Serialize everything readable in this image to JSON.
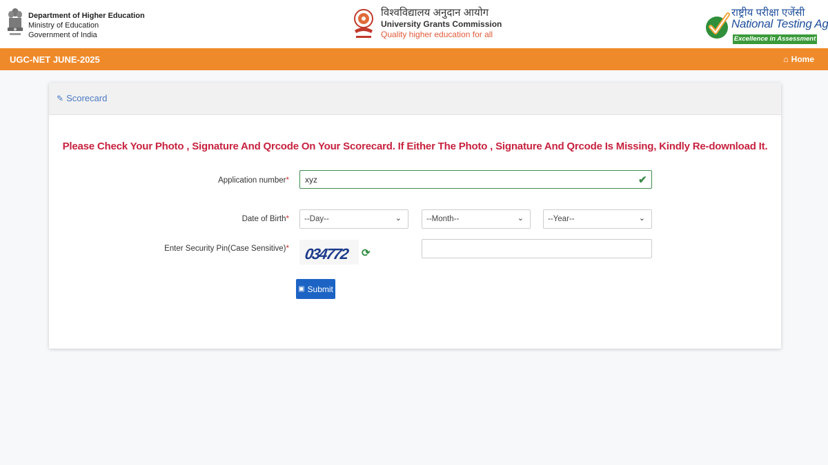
{
  "header": {
    "gov": {
      "department": "Department of Higher Education",
      "ministry": "Ministry of Education",
      "government": "Government of India"
    },
    "ugc": {
      "hindi_name": "विश्वविद्यालय अनुदान आयोग",
      "english_name": "University Grants Commission",
      "tagline": "Quality higher education for all"
    },
    "nta": {
      "hindi_name": "राष्ट्रीय परीक्षा एजेंसी",
      "english_name": "National Testing Agency",
      "badge": "Excellence in Assessment"
    }
  },
  "navbar": {
    "title": "UGC-NET JUNE-2025",
    "home_label": "Home"
  },
  "panel": {
    "title": "Scorecard",
    "notice": "Please Check Your Photo , Signature And Qrcode On Your Scorecard. If Either The Photo , Signature And Qrcode Is Missing, Kindly Re-download It."
  },
  "form": {
    "application": {
      "label": "Application number",
      "value": "xyz"
    },
    "dob": {
      "label": "Date of Birth",
      "day": "--Day--",
      "month": "--Month--",
      "year": "--Year--"
    },
    "pin": {
      "label": "Enter Security Pin(Case Sensitive)",
      "captcha": "034772",
      "value": ""
    },
    "required_mark": "*",
    "submit_label": "Submit"
  },
  "colors": {
    "orange_bar": "#ef8a2b",
    "notice_red": "#c7223f",
    "valid_green": "#3c8a4a",
    "submit_blue": "#1c63c4",
    "nta_blue": "#1f4e9b"
  },
  "icons": [
    "emblem-icon",
    "ugc-logo-icon",
    "nta-tick-icon",
    "home-icon",
    "edit-icon",
    "check-icon",
    "chevron-down-icon",
    "refresh-icon",
    "save-icon"
  ]
}
